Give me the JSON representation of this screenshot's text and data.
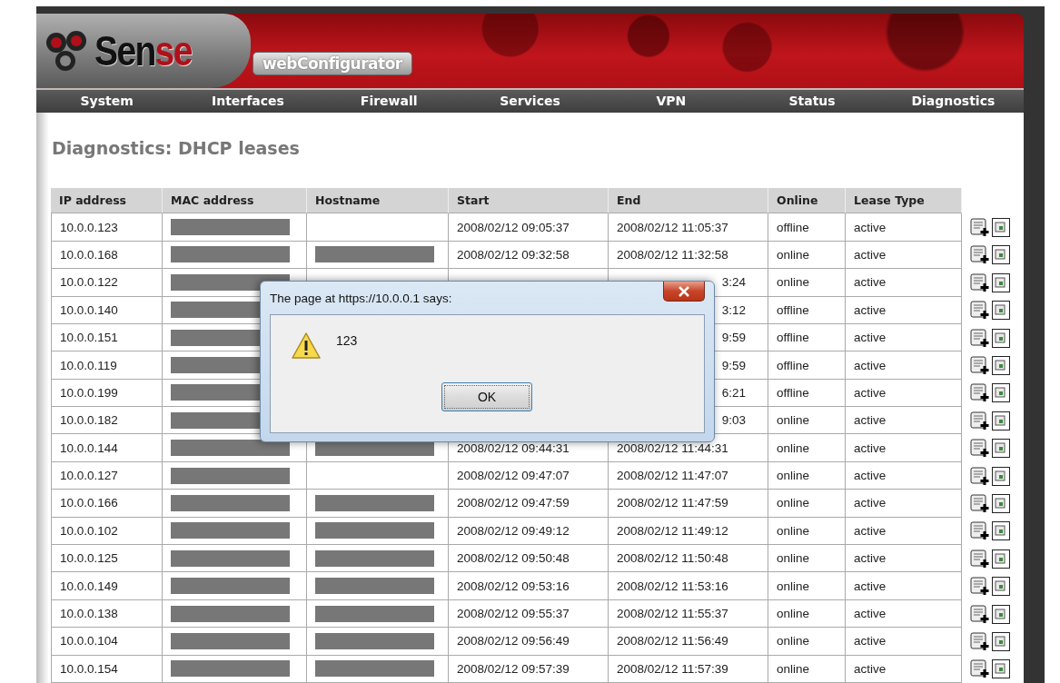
{
  "header": {
    "logo_name": "Sen",
    "logo_accent": "se",
    "product": "webConfigurator"
  },
  "nav": [
    "System",
    "Interfaces",
    "Firewall",
    "Services",
    "VPN",
    "Status",
    "Diagnostics"
  ],
  "page_title": "Diagnostics: DHCP leases",
  "table": {
    "columns": [
      "IP address",
      "MAC address",
      "Hostname",
      "Start",
      "End",
      "Online",
      "Lease Type"
    ],
    "rows": [
      {
        "ip": "10.0.0.123",
        "mac_redacted": true,
        "start": "2008/02/12 09:05:37",
        "end": "2008/02/12 11:05:37",
        "online": "offline",
        "lease_type": "active"
      },
      {
        "ip": "10.0.0.168",
        "mac_redacted": true,
        "hostname_redacted": true,
        "start": "2008/02/12 09:32:58",
        "end": "2008/02/12 11:32:58",
        "online": "online",
        "lease_type": "active"
      },
      {
        "ip": "10.0.0.122",
        "mac_redacted": true,
        "end": "3:24",
        "online": "online",
        "lease_type": "active"
      },
      {
        "ip": "10.0.0.140",
        "mac_redacted": true,
        "end": "3:12",
        "online": "offline",
        "lease_type": "active"
      },
      {
        "ip": "10.0.0.151",
        "mac_redacted": true,
        "end": "9:59",
        "online": "offline",
        "lease_type": "active"
      },
      {
        "ip": "10.0.0.119",
        "mac_redacted": true,
        "end": "9:59",
        "online": "offline",
        "lease_type": "active"
      },
      {
        "ip": "10.0.0.199",
        "mac_redacted": true,
        "end": "6:21",
        "online": "offline",
        "lease_type": "active"
      },
      {
        "ip": "10.0.0.182",
        "mac_redacted": true,
        "end": "9:03",
        "online": "online",
        "lease_type": "active"
      },
      {
        "ip": "10.0.0.144",
        "mac_redacted": true,
        "hostname_redacted": true,
        "start": "2008/02/12 09:44:31",
        "end": "2008/02/12 11:44:31",
        "online": "online",
        "lease_type": "active"
      },
      {
        "ip": "10.0.0.127",
        "mac_redacted": true,
        "start": "2008/02/12 09:47:07",
        "end": "2008/02/12 11:47:07",
        "online": "online",
        "lease_type": "active"
      },
      {
        "ip": "10.0.0.166",
        "mac_redacted": true,
        "hostname_redacted": true,
        "start": "2008/02/12 09:47:59",
        "end": "2008/02/12 11:47:59",
        "online": "online",
        "lease_type": "active"
      },
      {
        "ip": "10.0.0.102",
        "mac_redacted": true,
        "hostname_redacted": true,
        "start": "2008/02/12 09:49:12",
        "end": "2008/02/12 11:49:12",
        "online": "online",
        "lease_type": "active"
      },
      {
        "ip": "10.0.0.125",
        "mac_redacted": true,
        "hostname_redacted": true,
        "start": "2008/02/12 09:50:48",
        "end": "2008/02/12 11:50:48",
        "online": "online",
        "lease_type": "active"
      },
      {
        "ip": "10.0.0.149",
        "mac_redacted": true,
        "hostname_redacted": true,
        "start": "2008/02/12 09:53:16",
        "end": "2008/02/12 11:53:16",
        "online": "online",
        "lease_type": "active"
      },
      {
        "ip": "10.0.0.138",
        "mac_redacted": true,
        "hostname_redacted": true,
        "start": "2008/02/12 09:55:37",
        "end": "2008/02/12 11:55:37",
        "online": "online",
        "lease_type": "active"
      },
      {
        "ip": "10.0.0.104",
        "mac_redacted": true,
        "hostname_redacted": true,
        "start": "2008/02/12 09:56:49",
        "end": "2008/02/12 11:56:49",
        "online": "online",
        "lease_type": "active"
      },
      {
        "ip": "10.0.0.154",
        "mac_redacted": true,
        "hostname_redacted": true,
        "start": "2008/02/12 09:57:39",
        "end": "2008/02/12 11:57:39",
        "online": "online",
        "lease_type": "active"
      }
    ]
  },
  "dialog": {
    "title": "The page at https://10.0.0.1 says:",
    "message": "123",
    "button": "OK"
  }
}
